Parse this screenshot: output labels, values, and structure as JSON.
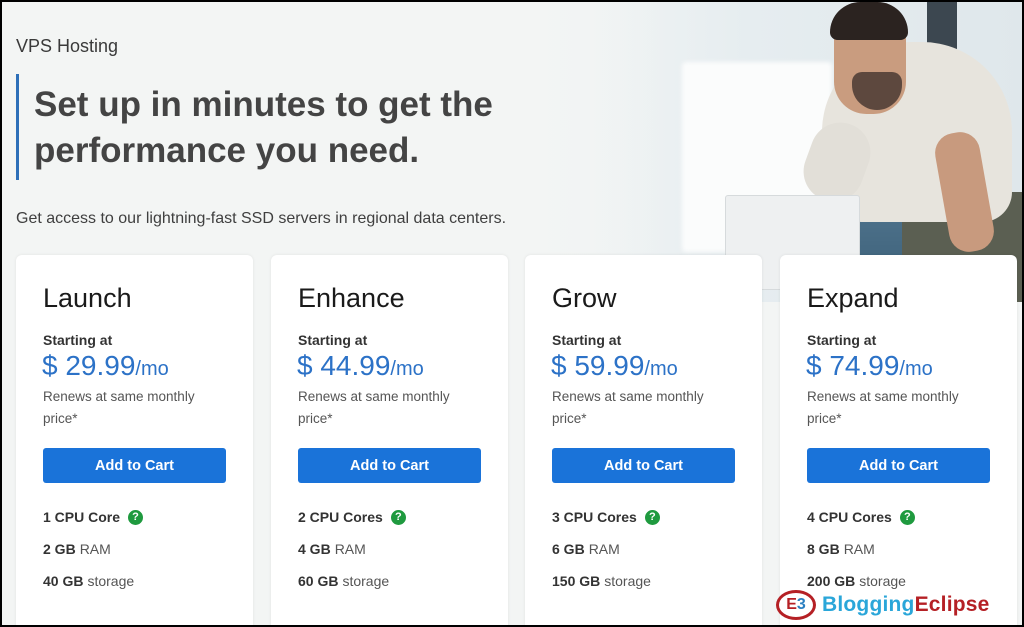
{
  "header": {
    "eyebrow": "VPS Hosting",
    "headline": "Set up in minutes to get the performance you need.",
    "subtext": "Get access to our lightning-fast SSD servers in regional data centers.",
    "accent_color": "#2d6fb8"
  },
  "plans": [
    {
      "name": "Launch",
      "starting_label": "Starting at",
      "price": "$ 29.99",
      "period": "/mo",
      "renew_note": "Renews at same monthly price*",
      "button_label": "Add to Cart",
      "cpu": "1 CPU Core",
      "ram_value": "2 GB",
      "ram_label": "RAM",
      "storage_value": "40 GB",
      "storage_label": "storage"
    },
    {
      "name": "Enhance",
      "starting_label": "Starting at",
      "price": "$ 44.99",
      "period": "/mo",
      "renew_note": "Renews at same monthly price*",
      "button_label": "Add to Cart",
      "cpu": "2 CPU Cores",
      "ram_value": "4 GB",
      "ram_label": "RAM",
      "storage_value": "60 GB",
      "storage_label": "storage"
    },
    {
      "name": "Grow",
      "starting_label": "Starting at",
      "price": "$ 59.99",
      "period": "/mo",
      "renew_note": "Renews at same monthly price*",
      "button_label": "Add to Cart",
      "cpu": "3 CPU Cores",
      "ram_value": "6 GB",
      "ram_label": "RAM",
      "storage_value": "150 GB",
      "storage_label": "storage"
    },
    {
      "name": "Expand",
      "starting_label": "Starting at",
      "price": "$ 74.99",
      "period": "/mo",
      "renew_note": "Renews at same monthly price*",
      "button_label": "Add to Cart",
      "cpu": "4 CPU Cores",
      "ram_value": "8 GB",
      "ram_label": "RAM",
      "storage_value": "200 GB",
      "storage_label": "storage"
    }
  ],
  "icons": {
    "help": "?",
    "help_icon_name": "question-circle-icon"
  },
  "colors": {
    "price": "#2c72c7",
    "button": "#1a73d9",
    "help_icon": "#1f9a3f"
  },
  "watermark": {
    "logo_glyph_a": "E",
    "logo_glyph_b": "3",
    "text_a": "Blogging",
    "text_b": "Eclipse"
  }
}
